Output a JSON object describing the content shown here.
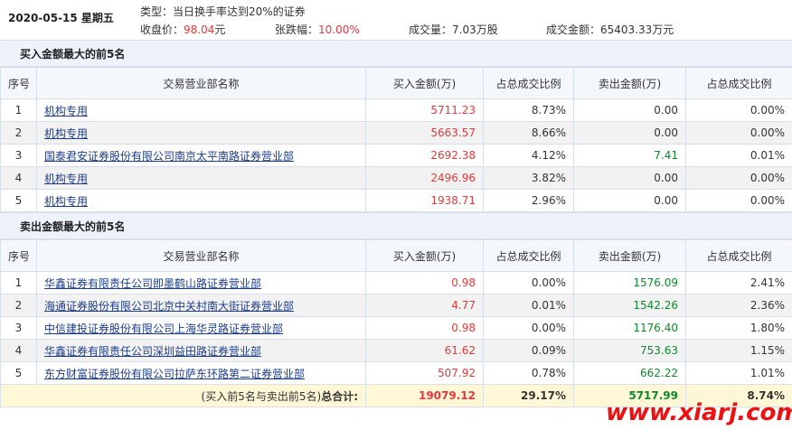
{
  "header": {
    "date": "2020-05-15 星期五",
    "type_label": "类型：",
    "type_value": "当日换手率达到20%的证券",
    "close_label": "收盘价：",
    "close_value": "98.04",
    "close_unit": "元",
    "change_label": "张跌幅：",
    "change_value": "10.00%",
    "volume_label": "成交量：",
    "volume_value": "7.03万股",
    "amount_label": "成交金额：",
    "amount_value": "65403.33万元"
  },
  "buy_section": {
    "title": "买入金额最大的前5名",
    "headers": [
      "序号",
      "交易营业部名称",
      "买入金额(万)",
      "占总成交比例",
      "卖出金额(万)",
      "占总成交比例"
    ],
    "rows": [
      {
        "no": "1",
        "name": "机构专用",
        "buy": "5711.23",
        "buy_pct": "8.73%",
        "sell": "0.00",
        "sell_pct": "0.00%"
      },
      {
        "no": "2",
        "name": "机构专用",
        "buy": "5663.57",
        "buy_pct": "8.66%",
        "sell": "0.00",
        "sell_pct": "0.00%"
      },
      {
        "no": "3",
        "name": "国泰君安证券股份有限公司南京太平南路证券营业部",
        "buy": "2692.38",
        "buy_pct": "4.12%",
        "sell": "7.41",
        "sell_pct": "0.01%"
      },
      {
        "no": "4",
        "name": "机构专用",
        "buy": "2496.96",
        "buy_pct": "3.82%",
        "sell": "0.00",
        "sell_pct": "0.00%"
      },
      {
        "no": "5",
        "name": "机构专用",
        "buy": "1938.71",
        "buy_pct": "2.96%",
        "sell": "0.00",
        "sell_pct": "0.00%"
      }
    ]
  },
  "sell_section": {
    "title": "卖出金额最大的前5名",
    "headers": [
      "序号",
      "交易营业部名称",
      "买入金额(万)",
      "占总成交比例",
      "卖出金额(万)",
      "占总成交比例"
    ],
    "rows": [
      {
        "no": "1",
        "name": "华鑫证券有限责任公司即墨鹤山路证券营业部",
        "buy": "0.98",
        "buy_pct": "0.00%",
        "sell": "1576.09",
        "sell_pct": "2.41%"
      },
      {
        "no": "2",
        "name": "海通证券股份有限公司北京中关村南大街证券营业部",
        "buy": "4.77",
        "buy_pct": "0.01%",
        "sell": "1542.26",
        "sell_pct": "2.36%"
      },
      {
        "no": "3",
        "name": "中信建投证券股份有限公司上海华灵路证券营业部",
        "buy": "0.98",
        "buy_pct": "0.00%",
        "sell": "1176.40",
        "sell_pct": "1.80%"
      },
      {
        "no": "4",
        "name": "华鑫证券有限责任公司深圳益田路证券营业部",
        "buy": "61.62",
        "buy_pct": "0.09%",
        "sell": "753.63",
        "sell_pct": "1.15%"
      },
      {
        "no": "5",
        "name": "东方财富证券股份有限公司拉萨东环路第二证券营业部",
        "buy": "507.92",
        "buy_pct": "0.78%",
        "sell": "662.22",
        "sell_pct": "1.01%"
      }
    ]
  },
  "total": {
    "label_prefix": "(买入前5名与卖出前5名)",
    "label_bold": "总合计:",
    "buy": "19079.12",
    "buy_pct": "29.17%",
    "sell": "5717.99",
    "sell_pct": "8.74%"
  },
  "watermark": "www.xiarj.com",
  "colors": {
    "buy": "#e4393c",
    "sell": "#0a8a2a",
    "link": "#1c3d8a",
    "section_bg": "#eef3fb",
    "total_bg": "#fff7d6"
  }
}
